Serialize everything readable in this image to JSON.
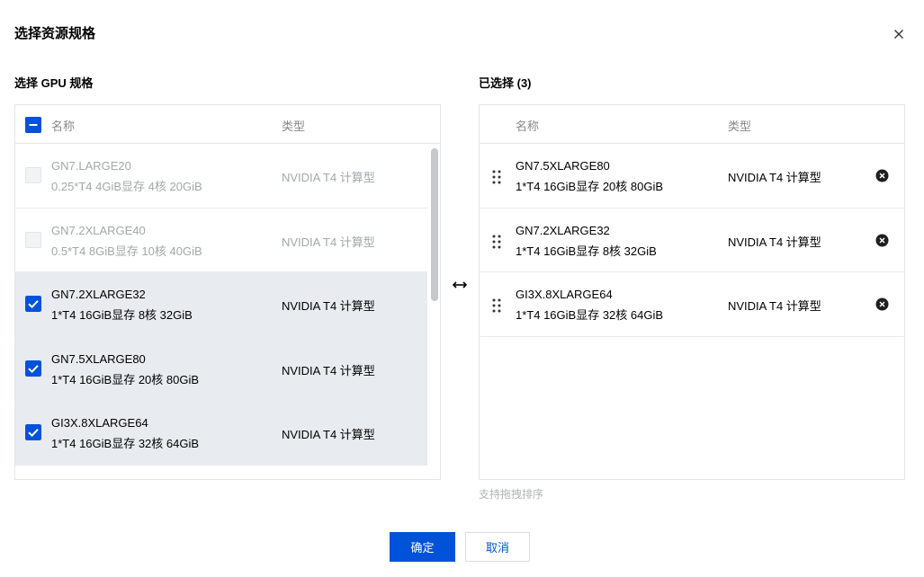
{
  "dialog": {
    "title": "选择资源规格",
    "close_icon": "close-icon"
  },
  "left": {
    "label": "选择 GPU 规格",
    "columns": {
      "name": "名称",
      "type": "类型"
    },
    "select_all_state": "indeterminate",
    "rows": [
      {
        "name": "GN7.LARGE20",
        "spec": "0.25*T4 4GiB显存 4核 20GiB",
        "type": "NVIDIA T4 计算型",
        "checked": false,
        "disabled": true
      },
      {
        "name": "GN7.2XLARGE40",
        "spec": "0.5*T4 8GiB显存 10核 40GiB",
        "type": "NVIDIA T4 计算型",
        "checked": false,
        "disabled": true
      },
      {
        "name": "GN7.2XLARGE32",
        "spec": "1*T4 16GiB显存 8核 32GiB",
        "type": "NVIDIA T4 计算型",
        "checked": true,
        "disabled": false
      },
      {
        "name": "GN7.5XLARGE80",
        "spec": "1*T4 16GiB显存 20核 80GiB",
        "type": "NVIDIA T4 计算型",
        "checked": true,
        "disabled": false
      },
      {
        "name": "GI3X.8XLARGE64",
        "spec": "1*T4 16GiB显存 32核 64GiB",
        "type": "NVIDIA T4 计算型",
        "checked": true,
        "disabled": false
      }
    ]
  },
  "right": {
    "label": "已选择 (3)",
    "columns": {
      "name": "名称",
      "type": "类型"
    },
    "rows": [
      {
        "name": "GN7.5XLARGE80",
        "spec": "1*T4 16GiB显存 20核 80GiB",
        "type": "NVIDIA T4 计算型"
      },
      {
        "name": "GN7.2XLARGE32",
        "spec": "1*T4 16GiB显存 8核 32GiB",
        "type": "NVIDIA T4 计算型"
      },
      {
        "name": "GI3X.8XLARGE64",
        "spec": "1*T4 16GiB显存 32核 64GiB",
        "type": "NVIDIA T4 计算型"
      }
    ],
    "hint": "支持拖拽排序"
  },
  "footer": {
    "confirm_label": "确定",
    "cancel_label": "取消"
  },
  "colors": {
    "primary": "#0052d9",
    "selected_row_bg": "#e8ebf0",
    "disabled_text": "#a3a6ab"
  }
}
